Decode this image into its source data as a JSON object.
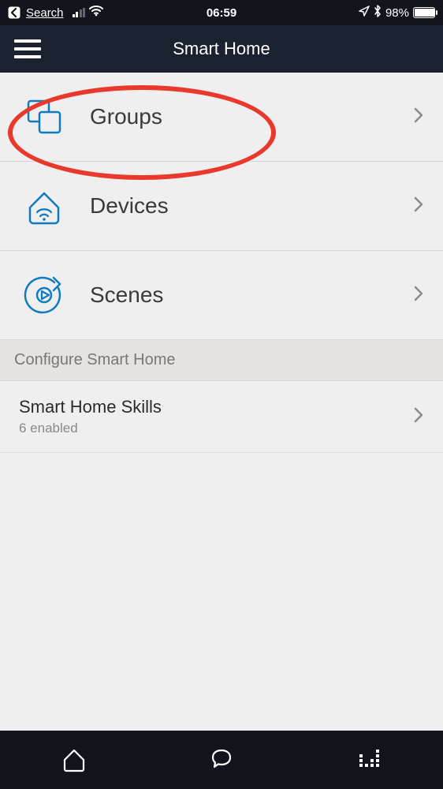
{
  "status_bar": {
    "back": "Search",
    "time": "06:59",
    "battery_pct": "98%"
  },
  "header": {
    "title": "Smart Home"
  },
  "menu": {
    "items": [
      {
        "key": "groups",
        "label": "Groups"
      },
      {
        "key": "devices",
        "label": "Devices"
      },
      {
        "key": "scenes",
        "label": "Scenes"
      }
    ]
  },
  "section": {
    "configure_label": "Configure Smart Home"
  },
  "skills": {
    "title": "Smart Home Skills",
    "subtitle": "6 enabled"
  },
  "annotation": {
    "highlight_target": "groups"
  },
  "colors": {
    "accent": "#0f7cc0",
    "highlight": "#e8392c",
    "header_bg": "#1b222f"
  }
}
